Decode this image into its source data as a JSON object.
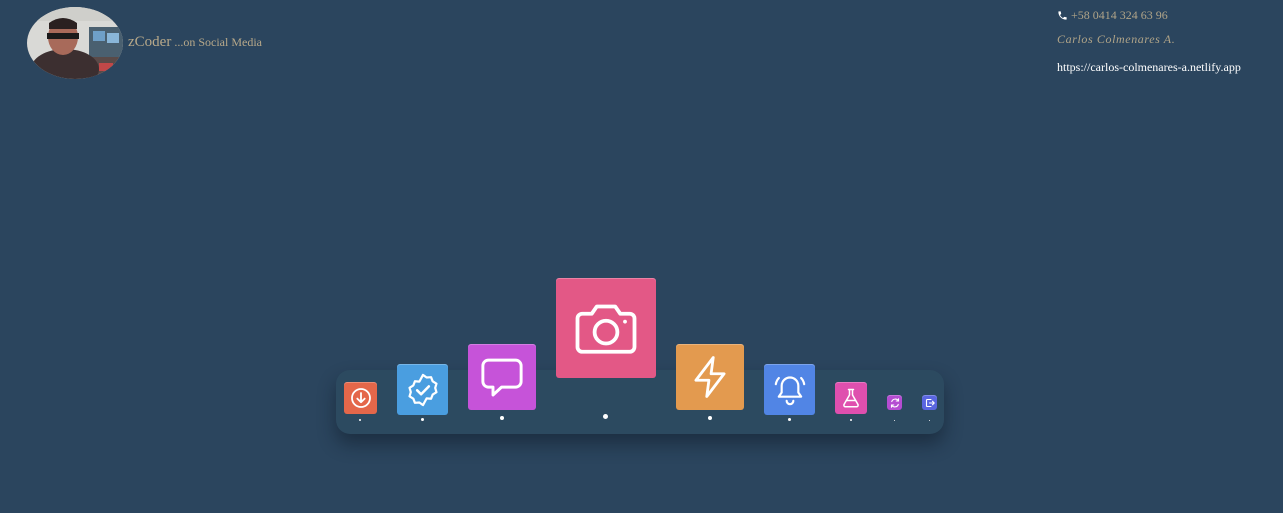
{
  "brand": {
    "name": "zCoder",
    "tagline": " ...on Social Media"
  },
  "contact": {
    "phone": "+58 0414 324 63 96",
    "name": "Carlos Colmenares A.",
    "url": "https://carlos-colmenares-a.netlify.app"
  },
  "colors": {
    "background": "#2b455e",
    "dock": "#2c4a60",
    "download": "#e4674a",
    "verified": "#4a9ee0",
    "chat": "#c653d9",
    "camera": "#e35886",
    "lightning": "#e39a4f",
    "bell": "#5185e5",
    "flask": "#df4fae",
    "sync": "#b54cd2",
    "logout": "#5a66e0"
  },
  "dock": {
    "items": [
      {
        "icon": "download-icon",
        "color": "#e4674a"
      },
      {
        "icon": "verified-icon",
        "color": "#4a9ee0"
      },
      {
        "icon": "chat-icon",
        "color": "#c653d9"
      },
      {
        "icon": "camera-icon",
        "color": "#e35886"
      },
      {
        "icon": "lightning-icon",
        "color": "#e39a4f"
      },
      {
        "icon": "bell-icon",
        "color": "#5185e5"
      },
      {
        "icon": "flask-icon",
        "color": "#df4fae"
      },
      {
        "icon": "sync-icon",
        "color": "#b54cd2"
      },
      {
        "icon": "logout-icon",
        "color": "#5a66e0"
      }
    ]
  }
}
